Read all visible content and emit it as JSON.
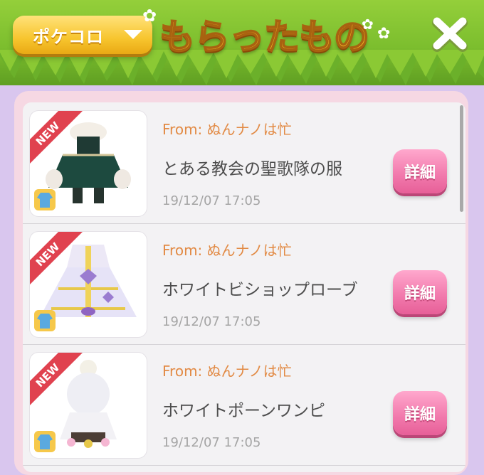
{
  "header": {
    "dropdown_label": "ポケコロ",
    "title": "もらったもの",
    "colors": {
      "grass": "#7cbe2e",
      "title": "#f6b626",
      "dropdown": "#f7c52e"
    }
  },
  "list": {
    "items": [
      {
        "new_badge": "NEW",
        "from": "From: ぬんナノは忙",
        "name": "とある教会の聖歌隊の服",
        "time": "19/12/07 17:05",
        "detail_label": "詳細",
        "icon": "dress-icon"
      },
      {
        "new_badge": "NEW",
        "from": "From: ぬんナノは忙",
        "name": "ホワイトビショップローブ",
        "time": "19/12/07 17:05",
        "detail_label": "詳細",
        "icon": "dress-icon"
      },
      {
        "new_badge": "NEW",
        "from": "From: ぬんナノは忙",
        "name": "ホワイトポーンワンピ",
        "time": "19/12/07 17:05",
        "detail_label": "詳細",
        "icon": "dress-icon"
      }
    ]
  },
  "colors": {
    "from_text": "#e28a44",
    "detail_button": "#f27cae",
    "new_ribbon": "#e0424f",
    "panel_bg": "#d9c6ee"
  }
}
